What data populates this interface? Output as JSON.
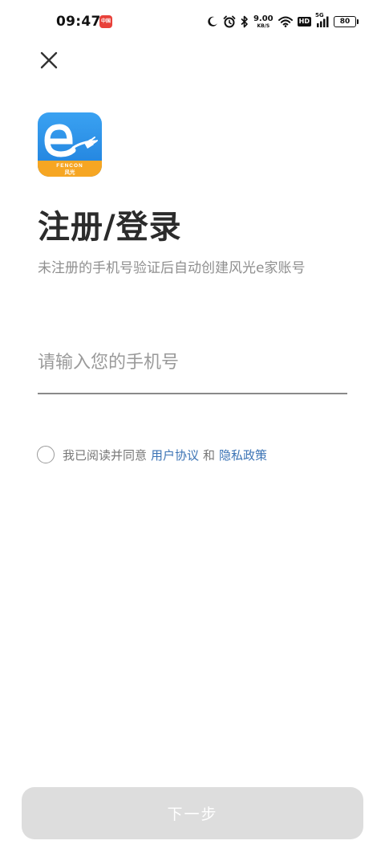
{
  "status_bar": {
    "time": "09:47",
    "app_badge": "中国铁",
    "net_speed_value": "9.00",
    "net_speed_unit": "KB/S",
    "hd_label": "HD",
    "network_label": "5G",
    "battery_level": "80"
  },
  "logo": {
    "brand_text": "FENCON",
    "brand_cn": "风光"
  },
  "login": {
    "title": "注册/登录",
    "subtitle": "未注册的手机号验证后自动创建风光e家账号",
    "phone_placeholder": "请输入您的手机号",
    "phone_value": ""
  },
  "agreement": {
    "prefix": "我已阅读并同意",
    "user_agreement": "用户协议",
    "and": "和",
    "privacy_policy": "隐私政策",
    "checked": false
  },
  "actions": {
    "next_label": "下一步"
  },
  "colors": {
    "link": "#3b73b5",
    "logo_top": "#2a8fe6",
    "logo_bottom": "#f6a623",
    "button_disabled": "#dddddd"
  }
}
